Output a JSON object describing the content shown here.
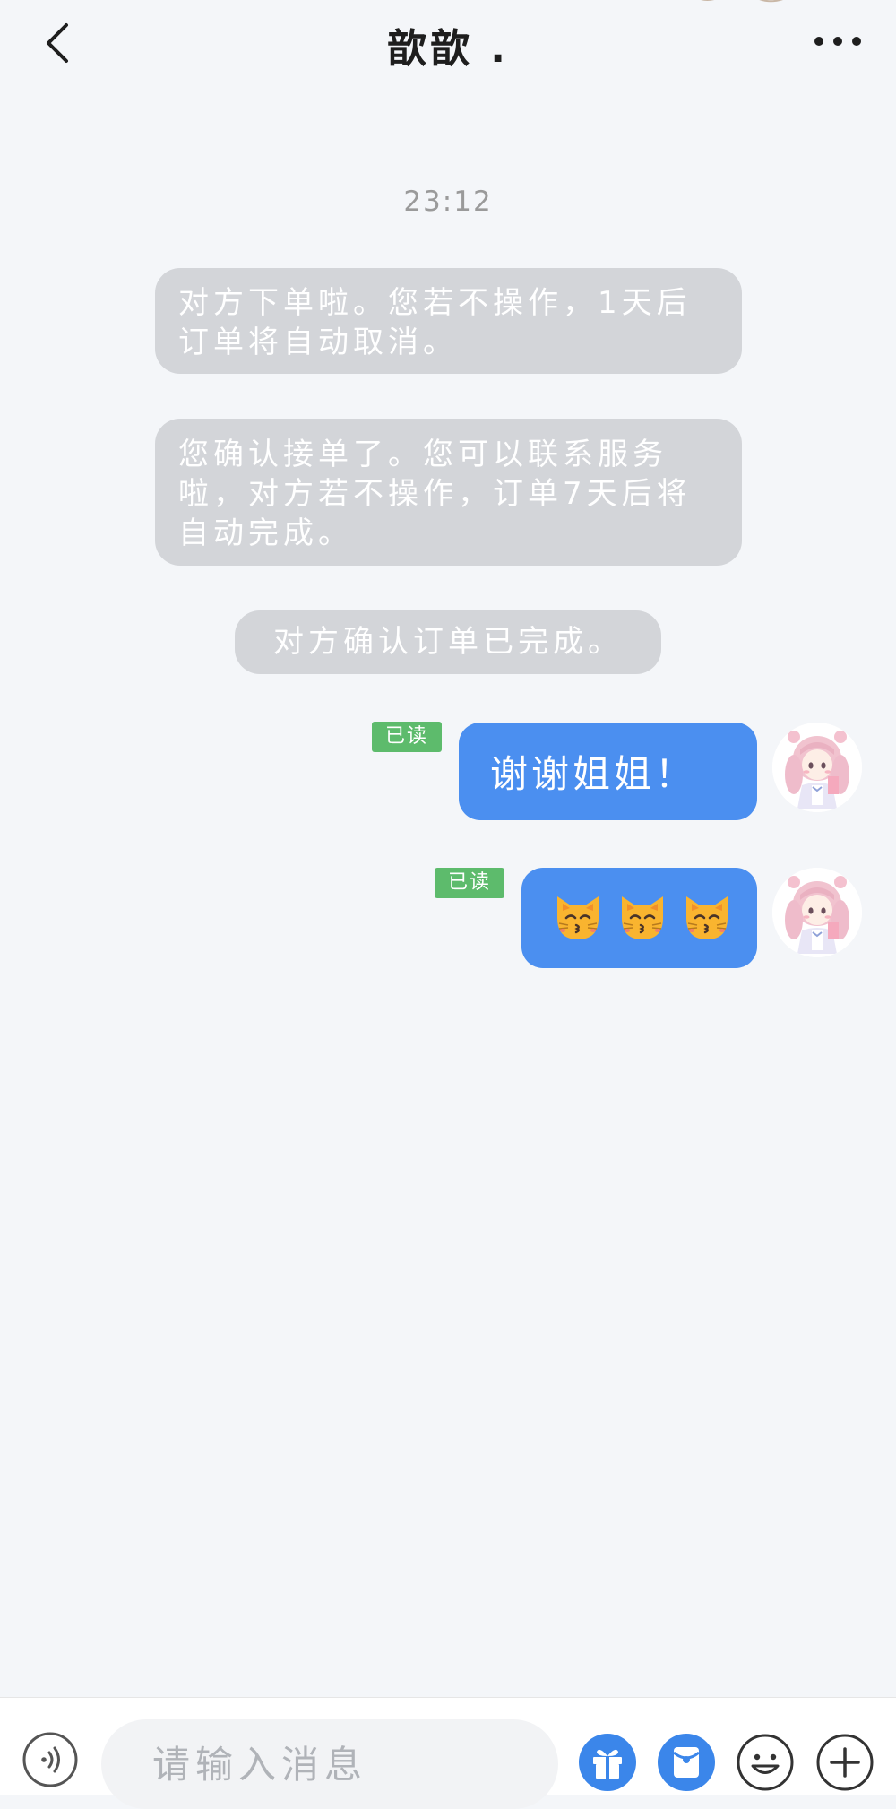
{
  "header": {
    "title": "歆歆 .",
    "back_icon": "chevron-left-icon",
    "more_icon": "more-horizontal-icon"
  },
  "timestamp": "23:12",
  "system_messages": [
    "对方下单啦。您若不操作，1天后订单将自动取消。",
    "您确认接单了。您可以联系服务啦，对方若不操作，订单7天后将自动完成。",
    "对方确认订单已完成。"
  ],
  "messages": [
    {
      "read_status": "已读",
      "text": "谢谢姐姐！",
      "avatar_icon": "avatar-anime-girl"
    },
    {
      "read_status": "已读",
      "emojis": [
        "😽",
        "😽",
        "😽"
      ],
      "avatar_icon": "avatar-anime-girl"
    }
  ],
  "input": {
    "placeholder": "请输入消息",
    "value": ""
  },
  "toolbar": {
    "voice_icon": "voice-icon",
    "gift_icon": "gift-icon",
    "redpacket_icon": "red-packet-icon",
    "emoji_icon": "smiley-icon",
    "plus_icon": "plus-icon"
  },
  "colors": {
    "background": "#f4f6f9",
    "sent_bubble": "#4b8ff0",
    "system_bubble": "#d3d5d9",
    "read_badge": "#5dbb6c",
    "tool_blue": "#3b86ea"
  }
}
